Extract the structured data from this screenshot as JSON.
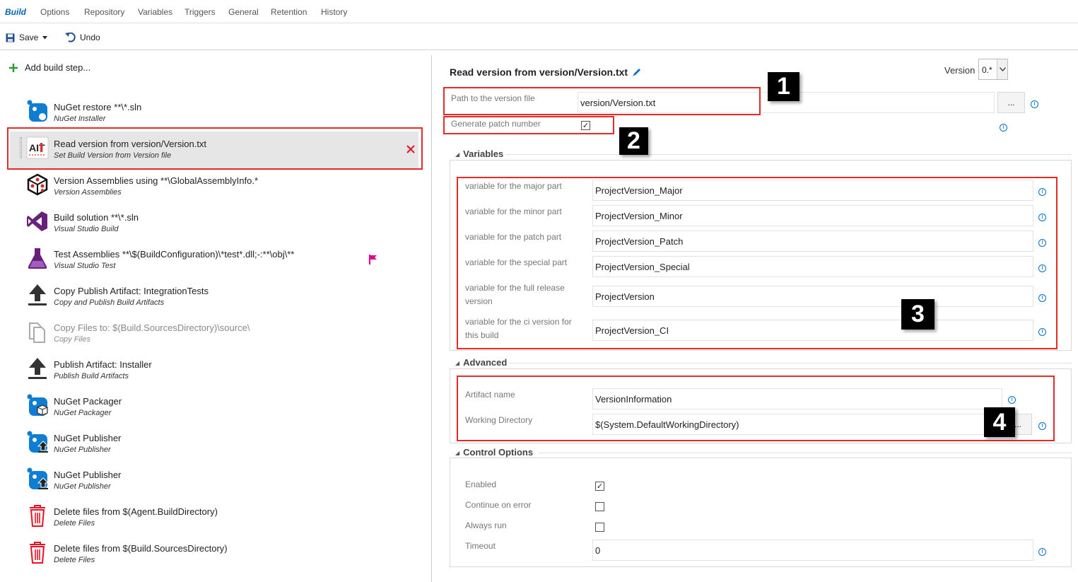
{
  "tabs": [
    "Build",
    "Options",
    "Repository",
    "Variables",
    "Triggers",
    "General",
    "Retention",
    "History"
  ],
  "toolbar": {
    "save_label": "Save",
    "undo_label": "Undo"
  },
  "add_step_label": "Add build step...",
  "steps": [
    {
      "title": "NuGet restore **\\*.sln",
      "subtitle": "NuGet Installer",
      "icon": "nuget-icon"
    },
    {
      "title": "Read version from version/Version.txt",
      "subtitle": "Set Build Version from Version file",
      "icon": "ait-icon"
    },
    {
      "title": "Version Assemblies using **\\GlobalAssemblyInfo.*",
      "subtitle": "Version Assemblies",
      "icon": "cube-icon"
    },
    {
      "title": "Build solution **\\*.sln",
      "subtitle": "Visual Studio Build",
      "icon": "visual-studio-icon"
    },
    {
      "title": "Test Assemblies **\\$(BuildConfiguration)\\*test*.dll;-:**\\obj\\**",
      "subtitle": "Visual Studio Test",
      "icon": "flask-icon"
    },
    {
      "title": "Copy Publish Artifact: IntegrationTests",
      "subtitle": "Copy and Publish Build Artifacts",
      "icon": "upload-arrow-icon"
    },
    {
      "title": "Copy Files to: $(Build.SourcesDirectory)\\source\\",
      "subtitle": "Copy Files",
      "icon": "copy-files-icon"
    },
    {
      "title": "Publish Artifact: Installer",
      "subtitle": "Publish Build Artifacts",
      "icon": "upload-arrow-icon"
    },
    {
      "title": "NuGet Packager",
      "subtitle": "NuGet Packager",
      "icon": "nuget-packager-icon"
    },
    {
      "title": "NuGet Publisher",
      "subtitle": "NuGet Publisher",
      "icon": "nuget-publisher-icon"
    },
    {
      "title": "NuGet Publisher",
      "subtitle": "NuGet Publisher",
      "icon": "nuget-publisher-icon"
    },
    {
      "title": "Delete files from $(Agent.BuildDirectory)",
      "subtitle": "Delete Files",
      "icon": "trash-icon"
    },
    {
      "title": "Delete files from $(Build.SourcesDirectory)",
      "subtitle": "Delete Files",
      "icon": "trash-icon"
    }
  ],
  "detail": {
    "title": "Read version from version/Version.txt",
    "version_label": "Version",
    "version_value": "0.*",
    "path_label": "Path to the version file",
    "path_value": "version/Version.txt",
    "browse_label": "...",
    "patch_label": "Generate patch number",
    "patch_checked": true,
    "variables_title": "Variables",
    "variables": [
      {
        "label": "variable for the major part",
        "value": "ProjectVersion_Major"
      },
      {
        "label": "variable for the minor part",
        "value": "ProjectVersion_Minor"
      },
      {
        "label": "variable for the patch part",
        "value": "ProjectVersion_Patch"
      },
      {
        "label": "variable for the special part",
        "value": "ProjectVersion_Special"
      },
      {
        "label": "variable for the full release version",
        "value": "ProjectVersion"
      },
      {
        "label": "variable for the ci version for this build",
        "value": "ProjectVersion_CI"
      }
    ],
    "advanced_title": "Advanced",
    "artifact_label": "Artifact name",
    "artifact_value": "VersionInformation",
    "workdir_label": "Working Directory",
    "workdir_value": "$(System.DefaultWorkingDirectory)",
    "control_title": "Control Options",
    "enabled_label": "Enabled",
    "continue_label": "Continue on error",
    "always_label": "Always run",
    "timeout_label": "Timeout",
    "timeout_value": "0"
  },
  "callouts": [
    "1",
    "2",
    "3",
    "4"
  ],
  "colors": {
    "accent": "#0066b8",
    "annotation": "#e52a2a",
    "delete": "#e81123",
    "flag": "#e3008c"
  }
}
